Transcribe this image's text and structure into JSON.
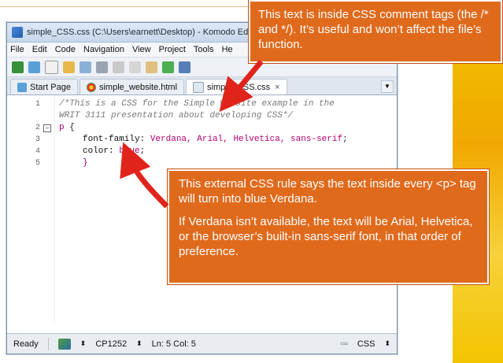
{
  "window": {
    "title": "simple_CSS.css (C:\\Users\\earnett\\Desktop) - Komodo Edit"
  },
  "menubar": [
    "File",
    "Edit",
    "Code",
    "Navigation",
    "View",
    "Project",
    "Tools",
    "He"
  ],
  "tabs": [
    {
      "label": "Start Page"
    },
    {
      "label": "simple_website.html"
    },
    {
      "label": "simple_CSS.css",
      "close": "×"
    }
  ],
  "editor": {
    "line_numbers": [
      "1",
      "",
      "2",
      "3",
      "4",
      "5"
    ],
    "lines": {
      "l1": "/*This is a CSS for the Simple Website example in the",
      "l1b": "WRIT 3111 presentation about developing CSS*/",
      "l2_sel": "p",
      "l2_brace": " {",
      "l3_prop": "font-family: ",
      "l3_val": "Verdana, Arial, Helvetica, sans-serif",
      "l3_end": ";",
      "l4_prop": "color: ",
      "l4_val": "blue",
      "l4_end": ";",
      "l5": "}"
    }
  },
  "statusbar": {
    "status": "Ready",
    "encoding": "CP1252",
    "position": "Ln: 5 Col: 5",
    "language": "CSS"
  },
  "callouts": {
    "top": "This text is inside CSS comment tags (the /* and */). It’s useful and won’t affect the file’s function.",
    "bottom_p1": "This external CSS rule says the text inside every <p> tag will turn into blue Verdana.",
    "bottom_p2": "If Verdana isn’t available, the text will be Arial, Helvetica, or the browser’s built-in sans-serif font, in that order of preference."
  },
  "colors": {
    "callout_bg": "#e06a1c",
    "accent_gold": "#f3c400",
    "arrow": "#e0241b"
  }
}
